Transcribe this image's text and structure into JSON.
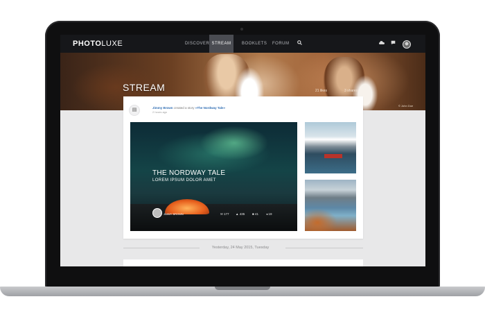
{
  "app": {
    "logo_bold": "PHOTO",
    "logo_light": "LUXE"
  },
  "nav": {
    "items": [
      {
        "label": "DISCOVER"
      },
      {
        "label": "STREAM"
      },
      {
        "label": "BOOKLETS"
      },
      {
        "label": "FORUM"
      }
    ],
    "active_index": 1,
    "icons": [
      "search-icon",
      "upload-icon",
      "chat-icon",
      "user-avatar"
    ]
  },
  "hero": {
    "title": "STREAM",
    "stat_left": "21 likes",
    "stat_right": "3 shares",
    "credit": "© John Doe"
  },
  "feed": {
    "activity": {
      "author": "Jimmy Brown",
      "action": "created a story",
      "story": "«The Nordway Tale»",
      "time": "2 hours ago"
    },
    "feature": {
      "title": "THE NORDWAY TALE",
      "subtitle": "LOREM IPSUM DOLOR AMET",
      "author": "JIMMY BROWN",
      "stats": [
        "177",
        "435",
        "41",
        "19"
      ]
    },
    "divider_date": "Yesterday, 24 May 2015, Tuesday"
  },
  "colors": {
    "nav_bg": "#16171a",
    "link": "#2f6db3",
    "accent_tent": "#e8611e"
  }
}
